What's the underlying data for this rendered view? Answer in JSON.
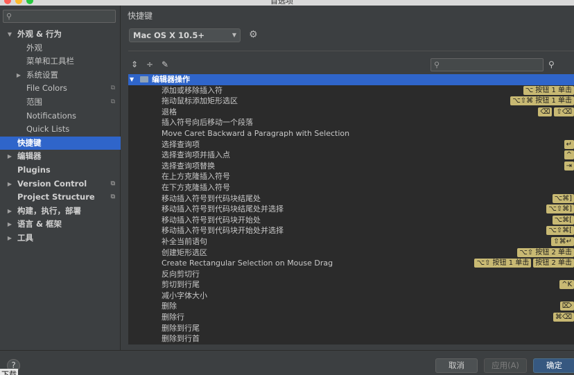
{
  "window": {
    "title": "首选项"
  },
  "sidebar": {
    "search_placeholder": "",
    "items": [
      {
        "label": "外观 & 行为",
        "level": 0,
        "expanded": true,
        "bold": true
      },
      {
        "label": "外观",
        "level": 1
      },
      {
        "label": "菜单和工具栏",
        "level": 1
      },
      {
        "label": "系统设置",
        "level": 1,
        "collapsed": true
      },
      {
        "label": "File Colors",
        "level": 1,
        "copy": true
      },
      {
        "label": "范围",
        "level": 1,
        "copy": true
      },
      {
        "label": "Notifications",
        "level": 1
      },
      {
        "label": "Quick Lists",
        "level": 1
      },
      {
        "label": "快捷键",
        "level": 0,
        "bold": true,
        "selected": true
      },
      {
        "label": "编辑器",
        "level": 0,
        "bold": true,
        "collapsed": true
      },
      {
        "label": "Plugins",
        "level": 0,
        "bold": true
      },
      {
        "label": "Version Control",
        "level": 0,
        "bold": true,
        "collapsed": true,
        "copy": true
      },
      {
        "label": "Project Structure",
        "level": 0,
        "bold": true,
        "copy": true
      },
      {
        "label": "构建，执行，部署",
        "level": 0,
        "bold": true,
        "collapsed": true
      },
      {
        "label": "语言 & 框架",
        "level": 0,
        "bold": true,
        "collapsed": true
      },
      {
        "label": "工具",
        "level": 0,
        "bold": true,
        "collapsed": true
      }
    ]
  },
  "main": {
    "title": "快捷键",
    "keymap": "Mac OS X 10.5+",
    "search_placeholder": ""
  },
  "table": {
    "group": "编辑器操作",
    "rows": [
      {
        "name": "添加或移除插入符",
        "shortcuts": [
          "⌥ 按钮 1 单击"
        ]
      },
      {
        "name": "拖动鼠标添加矩形选区",
        "shortcuts": [
          "⌥⇧⌘ 按钮 1 单击"
        ]
      },
      {
        "name": "退格",
        "shortcuts": [
          "⌫",
          "⇧⌫"
        ]
      },
      {
        "name": "插入符号向后移动一个段落",
        "shortcuts": []
      },
      {
        "name": "Move Caret Backward a Paragraph with Selection",
        "shortcuts": []
      },
      {
        "name": "选择查询项",
        "shortcuts": [
          "↵"
        ]
      },
      {
        "name": "选择查询项并插入点",
        "shortcuts": [
          "^"
        ]
      },
      {
        "name": "选择查询项替换",
        "shortcuts": [
          "⇥"
        ]
      },
      {
        "name": "在上方克隆插入符号",
        "shortcuts": []
      },
      {
        "name": "在下方克隆插入符号",
        "shortcuts": []
      },
      {
        "name": "移动插入符号到代码块结尾处",
        "shortcuts": [
          "⌥⌘]"
        ]
      },
      {
        "name": "移动插入符号到代码块结尾处并选择",
        "shortcuts": [
          "⌥⇧⌘]"
        ]
      },
      {
        "name": "移动插入符号到代码块开始处",
        "shortcuts": [
          "⌥⌘["
        ]
      },
      {
        "name": "移动插入符号到代码块开始处并选择",
        "shortcuts": [
          "⌥⇧⌘["
        ]
      },
      {
        "name": "补全当前语句",
        "shortcuts": [
          "⇧⌘↵"
        ]
      },
      {
        "name": "创建矩形选区",
        "shortcuts": [
          "⌥⇧ 按钮 2 单击"
        ]
      },
      {
        "name": "Create Rectangular Selection on Mouse Drag",
        "shortcuts": [
          "⌥⇧ 按钮 1 单击",
          "按钮 2 单击"
        ]
      },
      {
        "name": "反向剪切行",
        "shortcuts": []
      },
      {
        "name": "剪切到行尾",
        "shortcuts": [
          "^K"
        ]
      },
      {
        "name": "减小字体大小",
        "shortcuts": []
      },
      {
        "name": "删除",
        "shortcuts": [
          "⌦"
        ]
      },
      {
        "name": "删除行",
        "shortcuts": [
          "⌘⌫"
        ]
      },
      {
        "name": "删除到行尾",
        "shortcuts": []
      },
      {
        "name": "删除到行首",
        "shortcuts": []
      }
    ]
  },
  "footer": {
    "help": "?",
    "left_text": "下载",
    "cancel": "取消",
    "apply": "应用(A)",
    "ok": "确定"
  },
  "colors": {
    "selection": "#2f65ca",
    "badge": "#c8b973",
    "ok_button": "#365880"
  }
}
